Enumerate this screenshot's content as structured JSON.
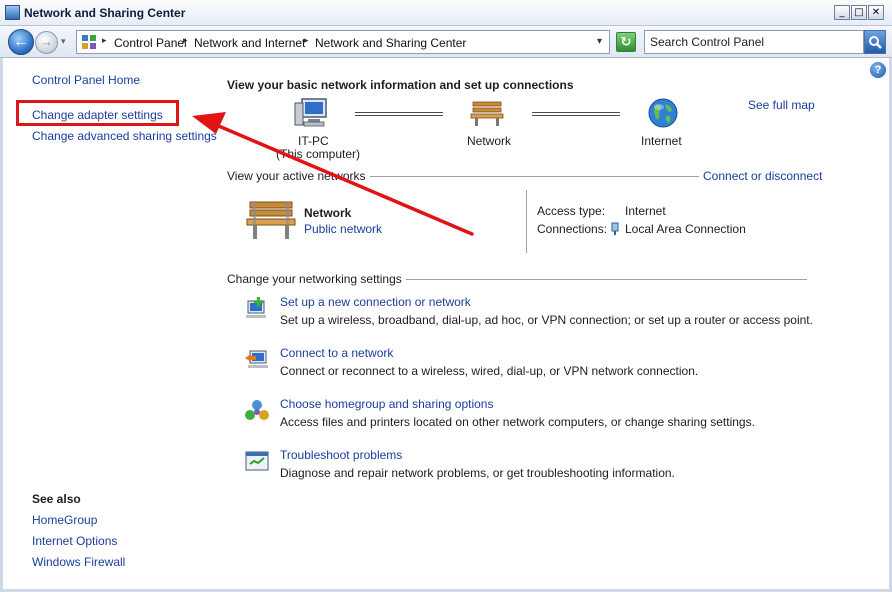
{
  "window": {
    "title": "Network and Sharing Center",
    "min_glyph": "_",
    "max_glyph": "□",
    "close_glyph": "✕"
  },
  "nav": {
    "back_glyph": "←",
    "forward_glyph": "→",
    "recent_glyph": "▾"
  },
  "address": {
    "sep_glyph": "▸",
    "dropdown_glyph": "▾",
    "crumbs": [
      "Control Panel",
      "Network and Internet",
      "Network and Sharing Center"
    ],
    "refresh_glyph": "↻"
  },
  "search": {
    "placeholder": "Search Control Panel"
  },
  "help_glyph": "?",
  "sidebar": {
    "links": [
      "Control Panel Home",
      "Change adapter settings",
      "Change advanced sharing settings"
    ],
    "see_also_heading": "See also",
    "see_also_links": [
      "HomeGroup",
      "Internet Options",
      "Windows Firewall"
    ]
  },
  "main": {
    "heading": "View your basic network information and set up connections",
    "see_full_map": "See full map",
    "map": {
      "computer_name": "IT-PC",
      "computer_sub": "(This computer)",
      "network": "Network",
      "internet": "Internet"
    },
    "active": {
      "label": "View your active networks",
      "connect_link": "Connect or disconnect",
      "network_name": "Network",
      "network_type": "Public network",
      "access_type_key": "Access type:",
      "access_type_val": "Internet",
      "connections_key": "Connections:",
      "connections_val": "Local Area Connection"
    },
    "settings": {
      "label": "Change your networking settings",
      "tasks": [
        {
          "title": "Set up a new connection or network",
          "desc": "Set up a wireless, broadband, dial-up, ad hoc, or VPN connection; or set up a router or access point."
        },
        {
          "title": "Connect to a network",
          "desc": "Connect or reconnect to a wireless, wired, dial-up, or VPN network connection."
        },
        {
          "title": "Choose homegroup and sharing options",
          "desc": "Access files and printers located on other network computers, or change sharing settings."
        },
        {
          "title": "Troubleshoot problems",
          "desc": "Diagnose and repair network problems, or get troubleshooting information."
        }
      ]
    }
  },
  "colors": {
    "link": "#1a3e9c",
    "highlight": "#e01414"
  }
}
